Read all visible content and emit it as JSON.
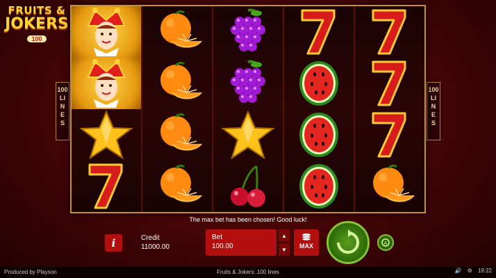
{
  "logo": {
    "line1": "FRUITS &",
    "line2": "JOKERS",
    "badge": "100"
  },
  "lines_label": {
    "number": "100",
    "text": "LINES"
  },
  "reels": [
    [
      "joker-icon",
      "joker-icon",
      "star-icon",
      "seven-icon"
    ],
    [
      "orange-icon",
      "orange-icon",
      "orange-icon",
      "orange-icon"
    ],
    [
      "grapes-icon",
      "grapes-icon",
      "star-icon",
      "cherry-icon"
    ],
    [
      "seven-icon",
      "watermelon-icon",
      "watermelon-icon",
      "watermelon-icon"
    ],
    [
      "seven-icon",
      "seven-icon",
      "seven-icon",
      "orange-icon"
    ]
  ],
  "message": "The max bet has been chosen! Good luck!",
  "credit": {
    "label": "Credit",
    "value": "11000.00"
  },
  "bet": {
    "label": "Bet",
    "value": "100.00"
  },
  "max_label": "MAX",
  "info_label": "i",
  "footer": {
    "produced": "Produced by Playson",
    "title": "Fruits & Jokers: 100 lines",
    "time": "19:22"
  },
  "colors": {
    "accent": "#b30f0f",
    "spin": "#5a9d1e",
    "frame": "#c7942b"
  }
}
